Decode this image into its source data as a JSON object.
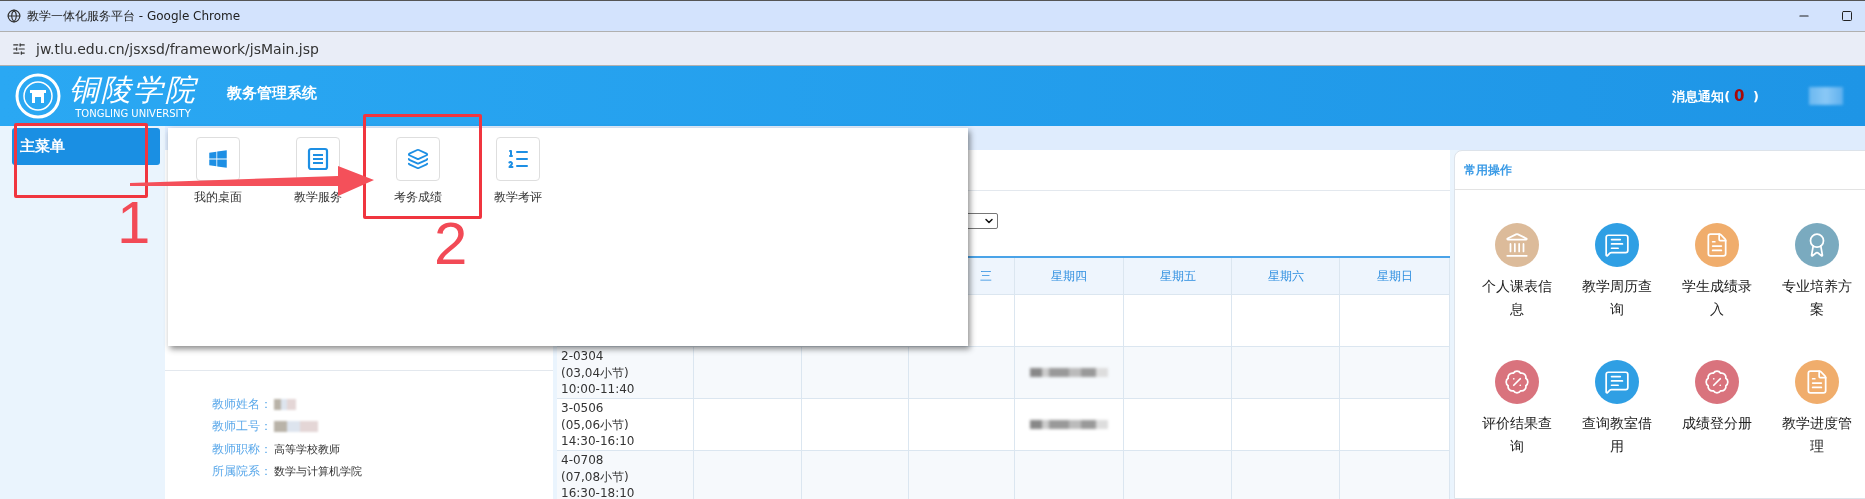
{
  "browser": {
    "title": "教学一体化服务平台 - Google Chrome",
    "url": "jw.tlu.edu.cn/jsxsd/framework/jsMain.jsp"
  },
  "header": {
    "logo_text": "铜陵学院",
    "logo_subtitle": "TONGLING UNIVERSITY",
    "system_name": "教务管理系统",
    "notification": {
      "label": "消息通知(",
      "count": "0",
      "suffix": " )"
    }
  },
  "sidebar": {
    "items": [
      {
        "label": "主菜单",
        "selected": true
      }
    ]
  },
  "main_menu": {
    "items": [
      {
        "label": "我的桌面",
        "kind": "windows"
      },
      {
        "label": "教学服务",
        "kind": "document"
      },
      {
        "label": "考务成绩",
        "kind": "layers"
      },
      {
        "label": "教学考评",
        "kind": "numbered-list"
      }
    ]
  },
  "teacher_info": [
    {
      "label": "教师姓名：",
      "redacted": true
    },
    {
      "label": "教师工号：",
      "redacted": true
    },
    {
      "label": "教师职称：",
      "redacted": false,
      "value": "高等学校教师"
    },
    {
      "label": "所属院系：",
      "redacted": false,
      "value": "数学与计算机学院"
    }
  ],
  "schedule": {
    "columns": [
      "三",
      "星期四",
      "星期五",
      "星期六",
      "星期日"
    ],
    "rows": [
      {
        "time": "2-0304\n(03,04小节)\n10:00-11:40",
        "course_redacted": true
      },
      {
        "time": "3-0506\n(05,06小节)\n14:30-16:10",
        "course_redacted": true
      },
      {
        "time": "4-0708\n(07,08小节)\n16:30-18:10",
        "course_redacted": false
      }
    ]
  },
  "quick_actions": {
    "title": "常用操作",
    "items": [
      {
        "label": "个人课表信息",
        "kind": "bank",
        "color": "#dcbb9a"
      },
      {
        "label": "教学周历查询",
        "kind": "chat",
        "color": "#2f9fe4"
      },
      {
        "label": "学生成绩录入",
        "kind": "document",
        "color": "#f0ad6c"
      },
      {
        "label": "专业培养方案",
        "kind": "award",
        "color": "#7aaabf"
      },
      {
        "label": "评价结果查询",
        "kind": "percent",
        "color": "#d9737d"
      },
      {
        "label": "查询教室借用",
        "kind": "chat",
        "color": "#2f9fe4"
      },
      {
        "label": "成绩登分册",
        "kind": "percent",
        "color": "#d9737d"
      },
      {
        "label": "教学进度管理",
        "kind": "document",
        "color": "#f0ad6c"
      }
    ]
  },
  "annotations": [
    {
      "label": "1"
    },
    {
      "label": "2"
    }
  ]
}
